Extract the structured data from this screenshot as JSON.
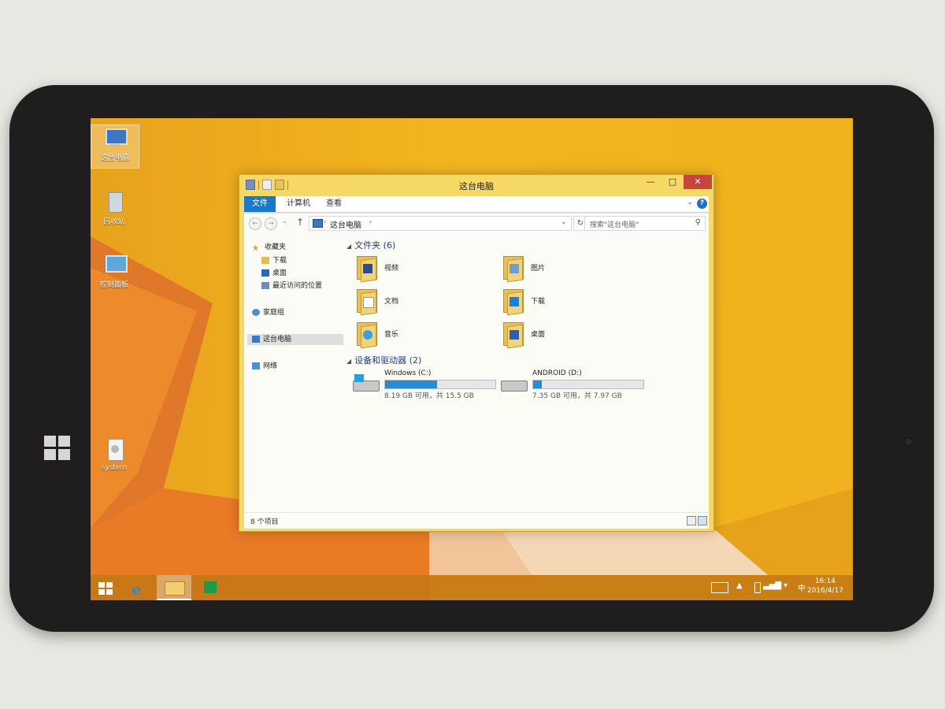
{
  "desktop": {
    "icons": [
      {
        "label": "这台电脑",
        "icon": "this-pc-icon"
      },
      {
        "label": "回收站",
        "icon": "recycle-bin-icon"
      },
      {
        "label": "控制面板",
        "icon": "control-panel-icon"
      },
      {
        "label": "system",
        "icon": "system-file-icon"
      }
    ]
  },
  "window": {
    "title": "这台电脑",
    "controls": {
      "minimize": "—",
      "maximize": "□",
      "close": "✕"
    },
    "ribbon_tabs": [
      {
        "label": "文件",
        "active": true
      },
      {
        "label": "计算机",
        "active": false
      },
      {
        "label": "查看",
        "active": false
      }
    ],
    "help_label": "?",
    "address": {
      "path": "这台电脑",
      "search_placeholder": "搜索\"这台电脑\""
    },
    "nav_pane": [
      {
        "label": "收藏夹",
        "icon": "star-icon"
      },
      {
        "label": "下载",
        "icon": "download-folder-icon"
      },
      {
        "label": "桌面",
        "icon": "desktop-folder-icon"
      },
      {
        "label": "最近访问的位置",
        "icon": "recent-places-icon"
      },
      {
        "label": "家庭组",
        "icon": "homegroup-icon"
      },
      {
        "label": "这台电脑",
        "icon": "this-pc-icon",
        "selected": true
      },
      {
        "label": "网络",
        "icon": "network-icon"
      }
    ],
    "folders_group": "文件夹 (6)",
    "folders": [
      {
        "label": "视频",
        "icon": "videos-folder-icon"
      },
      {
        "label": "图片",
        "icon": "pictures-folder-icon"
      },
      {
        "label": "文档",
        "icon": "documents-folder-icon"
      },
      {
        "label": "下载",
        "icon": "downloads-folder-icon"
      },
      {
        "label": "音乐",
        "icon": "music-folder-icon"
      },
      {
        "label": "桌面",
        "icon": "desktop-folder-icon"
      }
    ],
    "drives_group": "设备和驱动器 (2)",
    "drives": [
      {
        "name": "Windows (C:)",
        "size_text": "8.19 GB 可用，共 15.5 GB",
        "used_fraction": 0.47,
        "icon": "windows-drive-icon"
      },
      {
        "name": "ANDROID (D:)",
        "size_text": "7.35 GB 可用，共 7.97 GB",
        "used_fraction": 0.08,
        "icon": "drive-icon"
      }
    ],
    "status": "8 个项目"
  },
  "taskbar": {
    "buttons": [
      {
        "name": "start",
        "icon": "windows-start-icon"
      },
      {
        "name": "internet-explorer",
        "icon": "ie-icon"
      },
      {
        "name": "file-explorer",
        "icon": "file-explorer-icon",
        "active": true
      },
      {
        "name": "store",
        "icon": "store-icon"
      }
    ],
    "ime": "中",
    "time": "16:14",
    "date": "2016/4/17"
  },
  "colors": {
    "accent": "#1979ca",
    "wallpaper": "#f0b21e",
    "window_frame": "#f6d867",
    "close_button": "#c7453b"
  }
}
